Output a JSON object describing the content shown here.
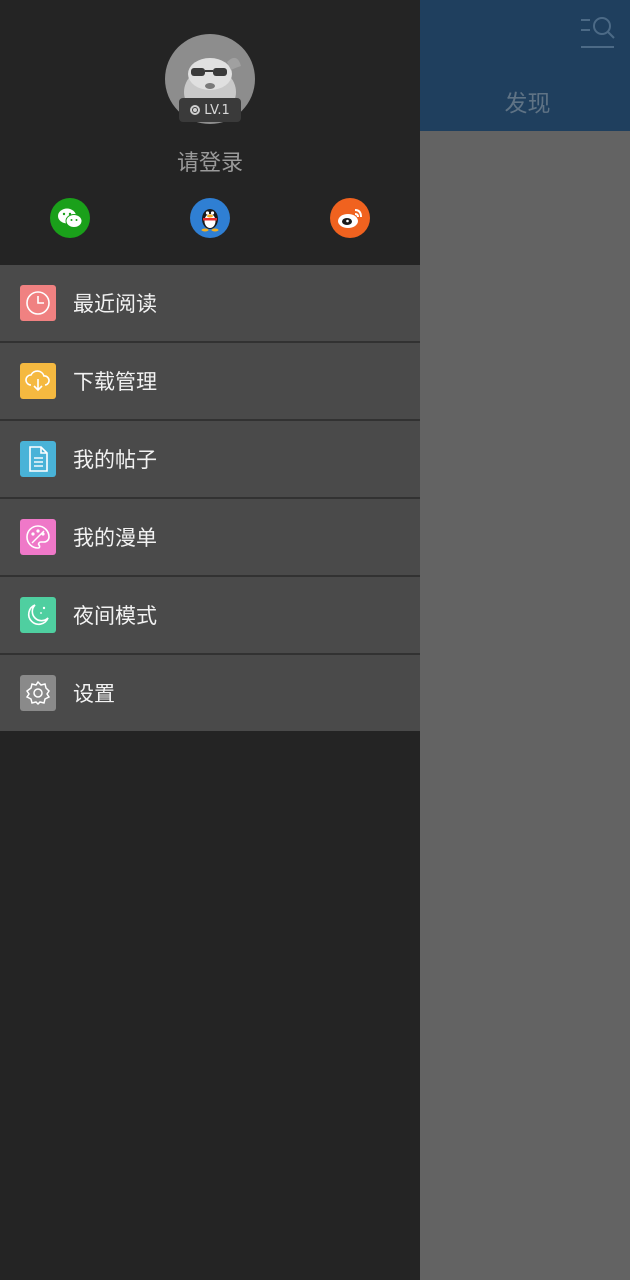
{
  "background_app": {
    "header_title": "发现"
  },
  "drawer": {
    "user": {
      "level": "LV.1",
      "login_prompt": "请登录"
    },
    "social_logins": [
      {
        "name": "wechat",
        "color": "#1aa01a"
      },
      {
        "name": "qq",
        "color": "#2f7fd3"
      },
      {
        "name": "weibo",
        "color": "#f0621f"
      }
    ],
    "menu": [
      {
        "label": "最近阅读",
        "icon": "clock-icon",
        "color": "#f08181"
      },
      {
        "label": "下载管理",
        "icon": "cloud-download-icon",
        "color": "#f5b940"
      },
      {
        "label": "我的帖子",
        "icon": "document-icon",
        "color": "#49b3d8"
      },
      {
        "label": "我的漫单",
        "icon": "palette-icon",
        "color": "#ef78c8"
      },
      {
        "label": "夜间模式",
        "icon": "moon-icon",
        "color": "#4fcfa0"
      },
      {
        "label": "设置",
        "icon": "gear-icon",
        "color": "#8a8a8a"
      }
    ]
  }
}
